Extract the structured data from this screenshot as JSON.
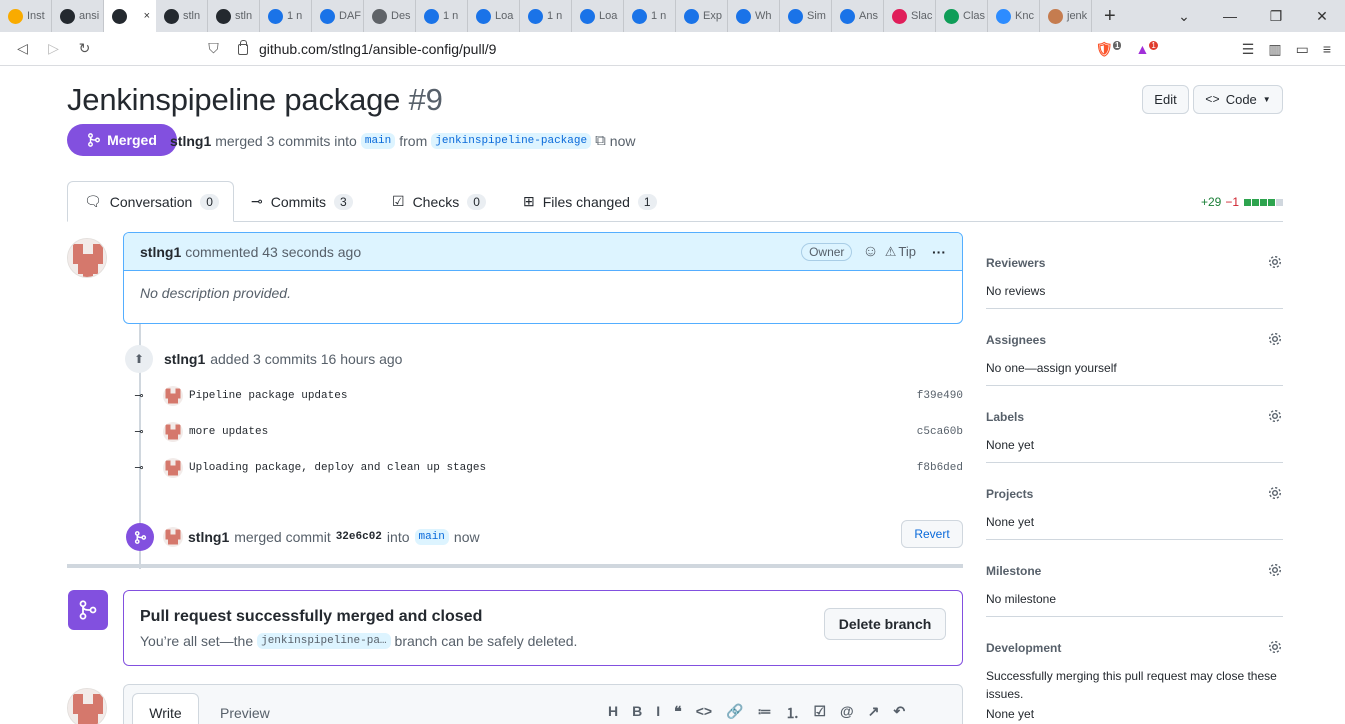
{
  "browser": {
    "tabs": [
      {
        "label": "Inst",
        "color": "#f9ab00"
      },
      {
        "label": "ansi",
        "color": "#24292f"
      },
      {
        "label": "",
        "color": "#24292f"
      },
      {
        "label": "stln",
        "color": "#24292f"
      },
      {
        "label": "stln",
        "color": "#24292f"
      },
      {
        "label": "1 n",
        "color": "#1a73e8"
      },
      {
        "label": "DAF",
        "color": "#1a73e8"
      },
      {
        "label": "Des",
        "color": "#5f6368"
      },
      {
        "label": "1 n",
        "color": "#1a73e8"
      },
      {
        "label": "Loa",
        "color": "#1a73e8"
      },
      {
        "label": "1 n",
        "color": "#1a73e8"
      },
      {
        "label": "Loa",
        "color": "#1a73e8"
      },
      {
        "label": "1 n",
        "color": "#1a73e8"
      },
      {
        "label": "Exp",
        "color": "#1a73e8"
      },
      {
        "label": "Wh",
        "color": "#1a73e8"
      },
      {
        "label": "Sim",
        "color": "#1a73e8"
      },
      {
        "label": "Ans",
        "color": "#1a73e8"
      },
      {
        "label": "Slac",
        "color": "#e01e5a"
      },
      {
        "label": "Clas",
        "color": "#0f9d58"
      },
      {
        "label": "Knc",
        "color": "#2d8cff"
      },
      {
        "label": "jenk",
        "color": "#c57c4f"
      }
    ],
    "active_tab_close": "×",
    "new_tab": "+",
    "url": "github.com/stlng1/ansible-config/pull/9",
    "brave_badge": "1",
    "rewards_badge": "1"
  },
  "pr": {
    "title": "Jenkinspipeline package",
    "number": "#9",
    "edit_label": "Edit",
    "code_label": "Code",
    "state_label": "Merged",
    "author": "stlng1",
    "merged_text": "merged 3 commits into",
    "base_branch": "main",
    "from_text": "from",
    "head_branch": "jenkinspipeline-package",
    "time": "now"
  },
  "tabs": [
    {
      "label": "Conversation",
      "count": "0"
    },
    {
      "label": "Commits",
      "count": "3"
    },
    {
      "label": "Checks",
      "count": "0"
    },
    {
      "label": "Files changed",
      "count": "1"
    }
  ],
  "diffstat": {
    "additions": "+29",
    "deletions": "−1"
  },
  "comment": {
    "author": "stlng1",
    "action": "commented 43 seconds ago",
    "badge": "Owner",
    "tip": "Tip",
    "body": "No description provided."
  },
  "commits_event": {
    "author": "stlng1",
    "text": "added 3 commits 16 hours ago"
  },
  "commits": [
    {
      "message": "Pipeline package updates",
      "sha": "f39e490"
    },
    {
      "message": "more updates",
      "sha": "c5ca60b"
    },
    {
      "message": "Uploading package, deploy and clean up stages",
      "sha": "f8b6ded"
    }
  ],
  "merge_event": {
    "author": "stlng1",
    "text": "merged commit",
    "sha": "32e6c02",
    "into": "into",
    "branch": "main",
    "time": "now",
    "revert_label": "Revert"
  },
  "merge_box": {
    "title": "Pull request successfully merged and closed",
    "sub_before": "You’re all set—the",
    "branch": "jenkinspipeline-pa…",
    "sub_after": "branch can be safely deleted.",
    "delete_label": "Delete branch"
  },
  "editor": {
    "write_label": "Write",
    "preview_label": "Preview",
    "tools": [
      "H",
      "B",
      "I",
      "❝",
      "<>",
      "🔗",
      "≔",
      "⒈",
      "☑",
      "@",
      "↗",
      "↶"
    ]
  },
  "sidebar": [
    {
      "heading": "Reviewers",
      "value": "No reviews"
    },
    {
      "heading": "Assignees",
      "value": "No one—assign yourself"
    },
    {
      "heading": "Labels",
      "value": "None yet"
    },
    {
      "heading": "Projects",
      "value": "None yet"
    },
    {
      "heading": "Milestone",
      "value": "No milestone"
    },
    {
      "heading": "Development",
      "value": "Successfully merging this pull request may close these issues.",
      "extra": "None yet"
    }
  ],
  "colors": {
    "merged": "#8250df",
    "accent_blue": "#0969da",
    "green": "#1a7f37",
    "red": "#cf222e"
  }
}
